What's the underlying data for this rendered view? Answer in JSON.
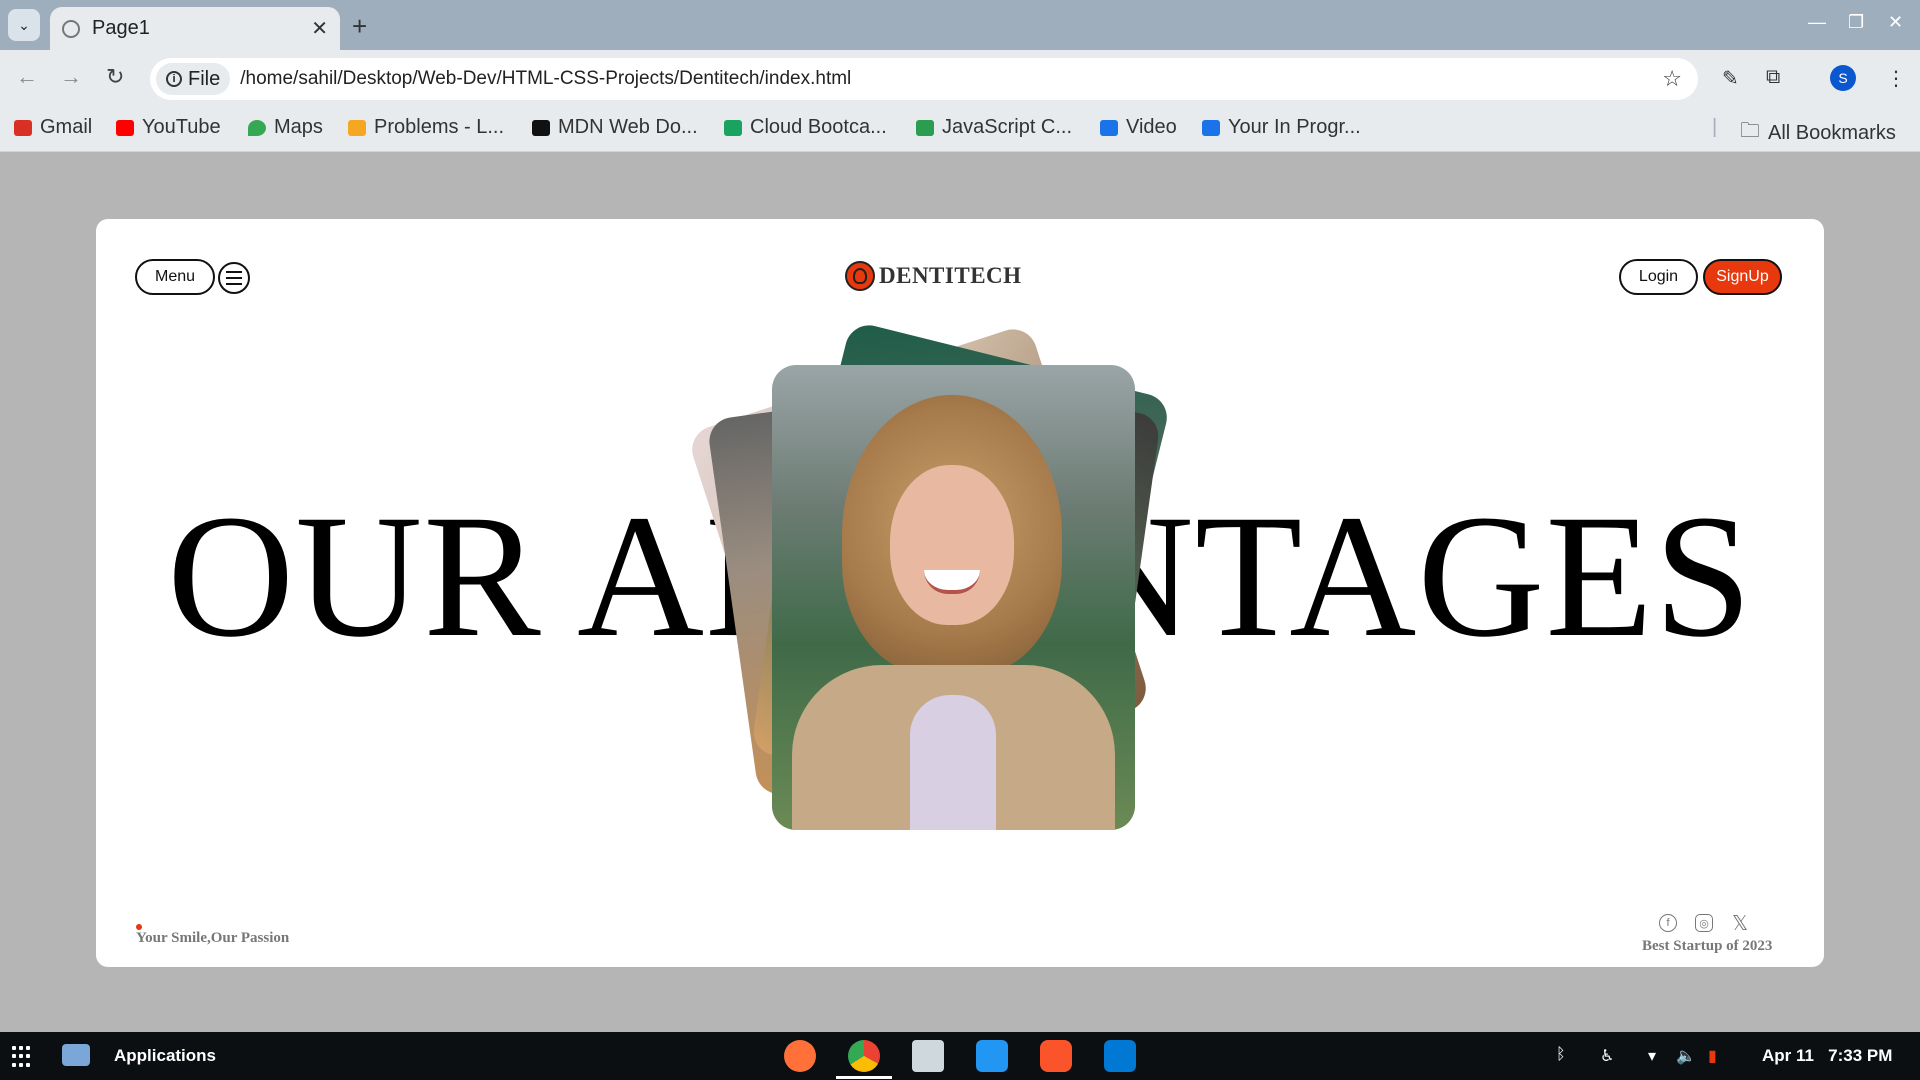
{
  "browser": {
    "tab_title": "Page1",
    "url_chip": "File",
    "url": "/home/sahil/Desktop/Web-Dev/HTML-CSS-Projects/Dentitech/index.html",
    "profile_initial": "S",
    "bookmarks": [
      {
        "label": "Gmail",
        "color": "#d93025"
      },
      {
        "label": "YouTube",
        "color": "#ff0000"
      },
      {
        "label": "Maps",
        "color": "#34a853"
      },
      {
        "label": "Problems - L...",
        "color": "#f5a623"
      },
      {
        "label": "MDN Web Do...",
        "color": "#111111"
      },
      {
        "label": "Cloud Bootca...",
        "color": "#1aa260"
      },
      {
        "label": "JavaScript C...",
        "color": "#2a9d4f"
      },
      {
        "label": "Video",
        "color": "#1a73e8"
      },
      {
        "label": "Your In Progr...",
        "color": "#1a73e8"
      }
    ],
    "all_bookmarks": "All Bookmarks"
  },
  "page": {
    "menu_label": "Menu",
    "brand": "DENTITECH",
    "login_label": "Login",
    "signup_label": "SignUp",
    "headline": "OUR ADVANTAGES",
    "tagline": "Your Smile,Our Passion",
    "award": "Best Startup of 2023",
    "accent_color": "#e8380d"
  },
  "taskbar": {
    "applications_label": "Applications",
    "date": "Apr 11",
    "time": "7:33 PM"
  }
}
